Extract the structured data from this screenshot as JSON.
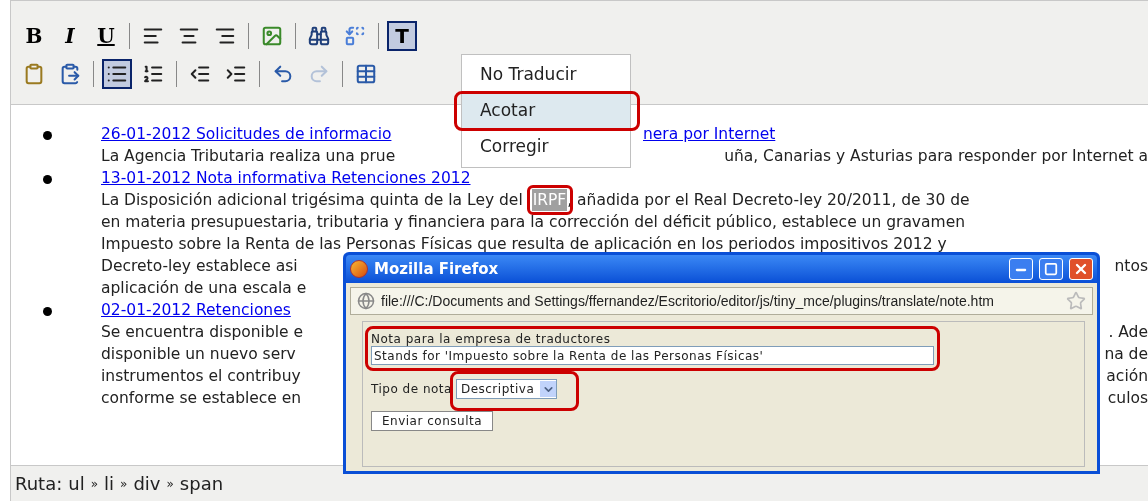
{
  "toolbar": {
    "rows": [
      [
        {
          "kind": "bold",
          "label": "B",
          "active": false,
          "disabled": false
        },
        {
          "kind": "italic",
          "label": "I",
          "active": false,
          "disabled": false
        },
        {
          "kind": "underline",
          "label": "U",
          "active": false,
          "disabled": false
        },
        {
          "kind": "separator"
        },
        {
          "kind": "align_left",
          "active": false,
          "disabled": false
        },
        {
          "kind": "align_center",
          "active": false,
          "disabled": false
        },
        {
          "kind": "align_right",
          "active": false,
          "disabled": false
        },
        {
          "kind": "separator"
        },
        {
          "kind": "image",
          "active": false,
          "disabled": false
        },
        {
          "kind": "separator"
        },
        {
          "kind": "find",
          "active": false,
          "disabled": false
        },
        {
          "kind": "replace",
          "active": false,
          "disabled": false
        },
        {
          "kind": "separator"
        },
        {
          "kind": "translate",
          "label": "T",
          "active": true,
          "disabled": false
        }
      ],
      [
        {
          "kind": "paste_text",
          "active": false,
          "disabled": false
        },
        {
          "kind": "paste_word",
          "active": false,
          "disabled": false
        },
        {
          "kind": "separator"
        },
        {
          "kind": "bullet_list",
          "active": true,
          "disabled": false
        },
        {
          "kind": "numbered_list",
          "active": false,
          "disabled": false
        },
        {
          "kind": "separator"
        },
        {
          "kind": "outdent",
          "active": false,
          "disabled": false
        },
        {
          "kind": "indent",
          "active": false,
          "disabled": false
        },
        {
          "kind": "separator"
        },
        {
          "kind": "undo",
          "active": false,
          "disabled": false
        },
        {
          "kind": "redo",
          "active": false,
          "disabled": true
        },
        {
          "kind": "separator"
        },
        {
          "kind": "table_edit",
          "active": false,
          "disabled": false
        }
      ]
    ]
  },
  "content": {
    "items": [
      {
        "link": {
          "left": "26-01-2012 Solicitudes de informacio",
          "right": "nera por Internet"
        },
        "lines": [
          {
            "left": "La Agencia Tributaria realiza una prue",
            "right": "uña, Canarias y Asturias para responder por Internet a"
          }
        ]
      },
      {
        "link": {
          "left": "13-01-2012 Nota informativa Retenciones 2012"
        },
        "lines": [
          {
            "left": "La Disposición adicional trigésima quinta de la Ley del ",
            "highlight": "IRPF",
            "after": ", añadida por el Real Decreto-ley 20/2011, de 30 de"
          },
          {
            "left": "en materia presupuestaria, tributaria y financiera para la corrección del déficit público, establece un gravamen"
          },
          {
            "left": "Impuesto sobre la Renta de las Personas Físicas que resulta de aplicación en los periodos impositivos 2012 y"
          },
          {
            "left": "Decreto-ley establece asi",
            "right": "ntos"
          },
          {
            "left": "aplicación de una escala e"
          }
        ]
      },
      {
        "link": {
          "left": "02-01-2012 Retenciones"
        },
        "lines": [
          {
            "left": "Se encuentra disponible e",
            "right": ". Ade"
          },
          {
            "left": "disponible un nuevo serv",
            "right": "na de"
          },
          {
            "left": "instrumentos el contribuy",
            "right": "ación"
          },
          {
            "left": "conforme se establece en",
            "right": "culos"
          }
        ]
      }
    ]
  },
  "status_bar": {
    "label": "Ruta:",
    "path": [
      {
        "text": "ul"
      },
      {
        "text": "»"
      },
      {
        "text": "li"
      },
      {
        "text": "»"
      },
      {
        "text": "div"
      },
      {
        "text": "»"
      },
      {
        "text": "span"
      }
    ]
  },
  "menu": {
    "items": [
      {
        "label": "No Traducir",
        "selected": false
      },
      {
        "label": "Acotar",
        "selected": true
      },
      {
        "label": "Corregir",
        "selected": false
      }
    ]
  },
  "dialog": {
    "title": "Mozilla Firefox",
    "url": "file:///C:/Documents and Settings/ffernandez/Escritorio/editor/js/tiny_mce/plugins/translate/note.htm",
    "note_label": "Nota para la empresa de traductores",
    "note_value": "Stands for 'Impuesto sobre la Renta de las Personas Físicas'",
    "type_label": "Tipo de nota",
    "type_value": "Descriptiva",
    "submit": "Enviar consulta"
  }
}
